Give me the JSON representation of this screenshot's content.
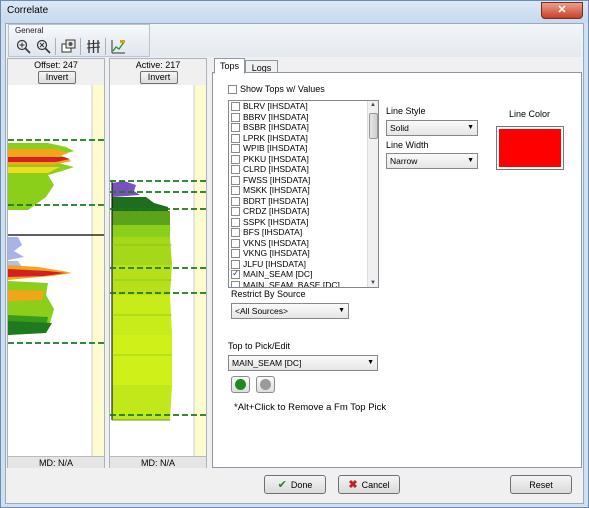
{
  "window": {
    "title": "Correlate",
    "close_glyph": "✕"
  },
  "toolbar": {
    "group_label": "General",
    "icons": [
      "zoom-in-icon",
      "zoom-out-icon",
      "copy-settings-icon",
      "tracks-icon",
      "chart-edit-icon"
    ]
  },
  "offset_panel": {
    "label": "Offset: 247",
    "invert_label": "Invert",
    "md_label": "MD: N/A"
  },
  "active_panel": {
    "label": "Active: 217",
    "invert_label": "Invert",
    "md_label": "MD: N/A"
  },
  "tabs": [
    {
      "label": "Tops",
      "active": true
    },
    {
      "label": "Logs",
      "active": false
    }
  ],
  "tops": {
    "show_values_label": "Show Tops w/ Values",
    "show_values_checked": false,
    "items": [
      {
        "label": "BLRV [IHSDATA]",
        "checked": false
      },
      {
        "label": "BBRV [IHSDATA]",
        "checked": false
      },
      {
        "label": "BSBR [IHSDATA]",
        "checked": false
      },
      {
        "label": "LPRK [IHSDATA]",
        "checked": false
      },
      {
        "label": "WPIB [IHSDATA]",
        "checked": false
      },
      {
        "label": "PKKU [IHSDATA]",
        "checked": false
      },
      {
        "label": "CLRD [IHSDATA]",
        "checked": false
      },
      {
        "label": "FWSS [IHSDATA]",
        "checked": false
      },
      {
        "label": "MSKK [IHSDATA]",
        "checked": false
      },
      {
        "label": "BDRT [IHSDATA]",
        "checked": false
      },
      {
        "label": "CRDZ [IHSDATA]",
        "checked": false
      },
      {
        "label": "SSPK [IHSDATA]",
        "checked": false
      },
      {
        "label": "BFS [IHSDATA]",
        "checked": false
      },
      {
        "label": "VKNS [IHSDATA]",
        "checked": false
      },
      {
        "label": "VKNG [IHSDATA]",
        "checked": false
      },
      {
        "label": "JLFU [IHSDATA]",
        "checked": false
      },
      {
        "label": "MAIN_SEAM [DC]",
        "checked": true
      },
      {
        "label": "MAIN_SEAM_BASE [DC]",
        "checked": false
      }
    ],
    "line_style_label": "Line Style",
    "line_style_value": "Solid",
    "line_width_label": "Line Width",
    "line_width_value": "Narrow",
    "line_color_label": "Line Color",
    "line_color": "#ff0000",
    "restrict_label": "Restrict By Source",
    "restrict_value": "<All Sources>",
    "pick_label": "Top to Pick/Edit",
    "pick_value": "MAIN_SEAM [DC]",
    "hint": "*Alt+Click to Remove a Fm Top Pick"
  },
  "buttons": {
    "done": "Done",
    "cancel": "Cancel",
    "reset": "Reset"
  },
  "colors": {
    "pick_green": "#1f8a1f",
    "pick_gray": "#9a9a9a",
    "accent_red": "#ff0000",
    "dash_green": "#1a7a1a"
  }
}
